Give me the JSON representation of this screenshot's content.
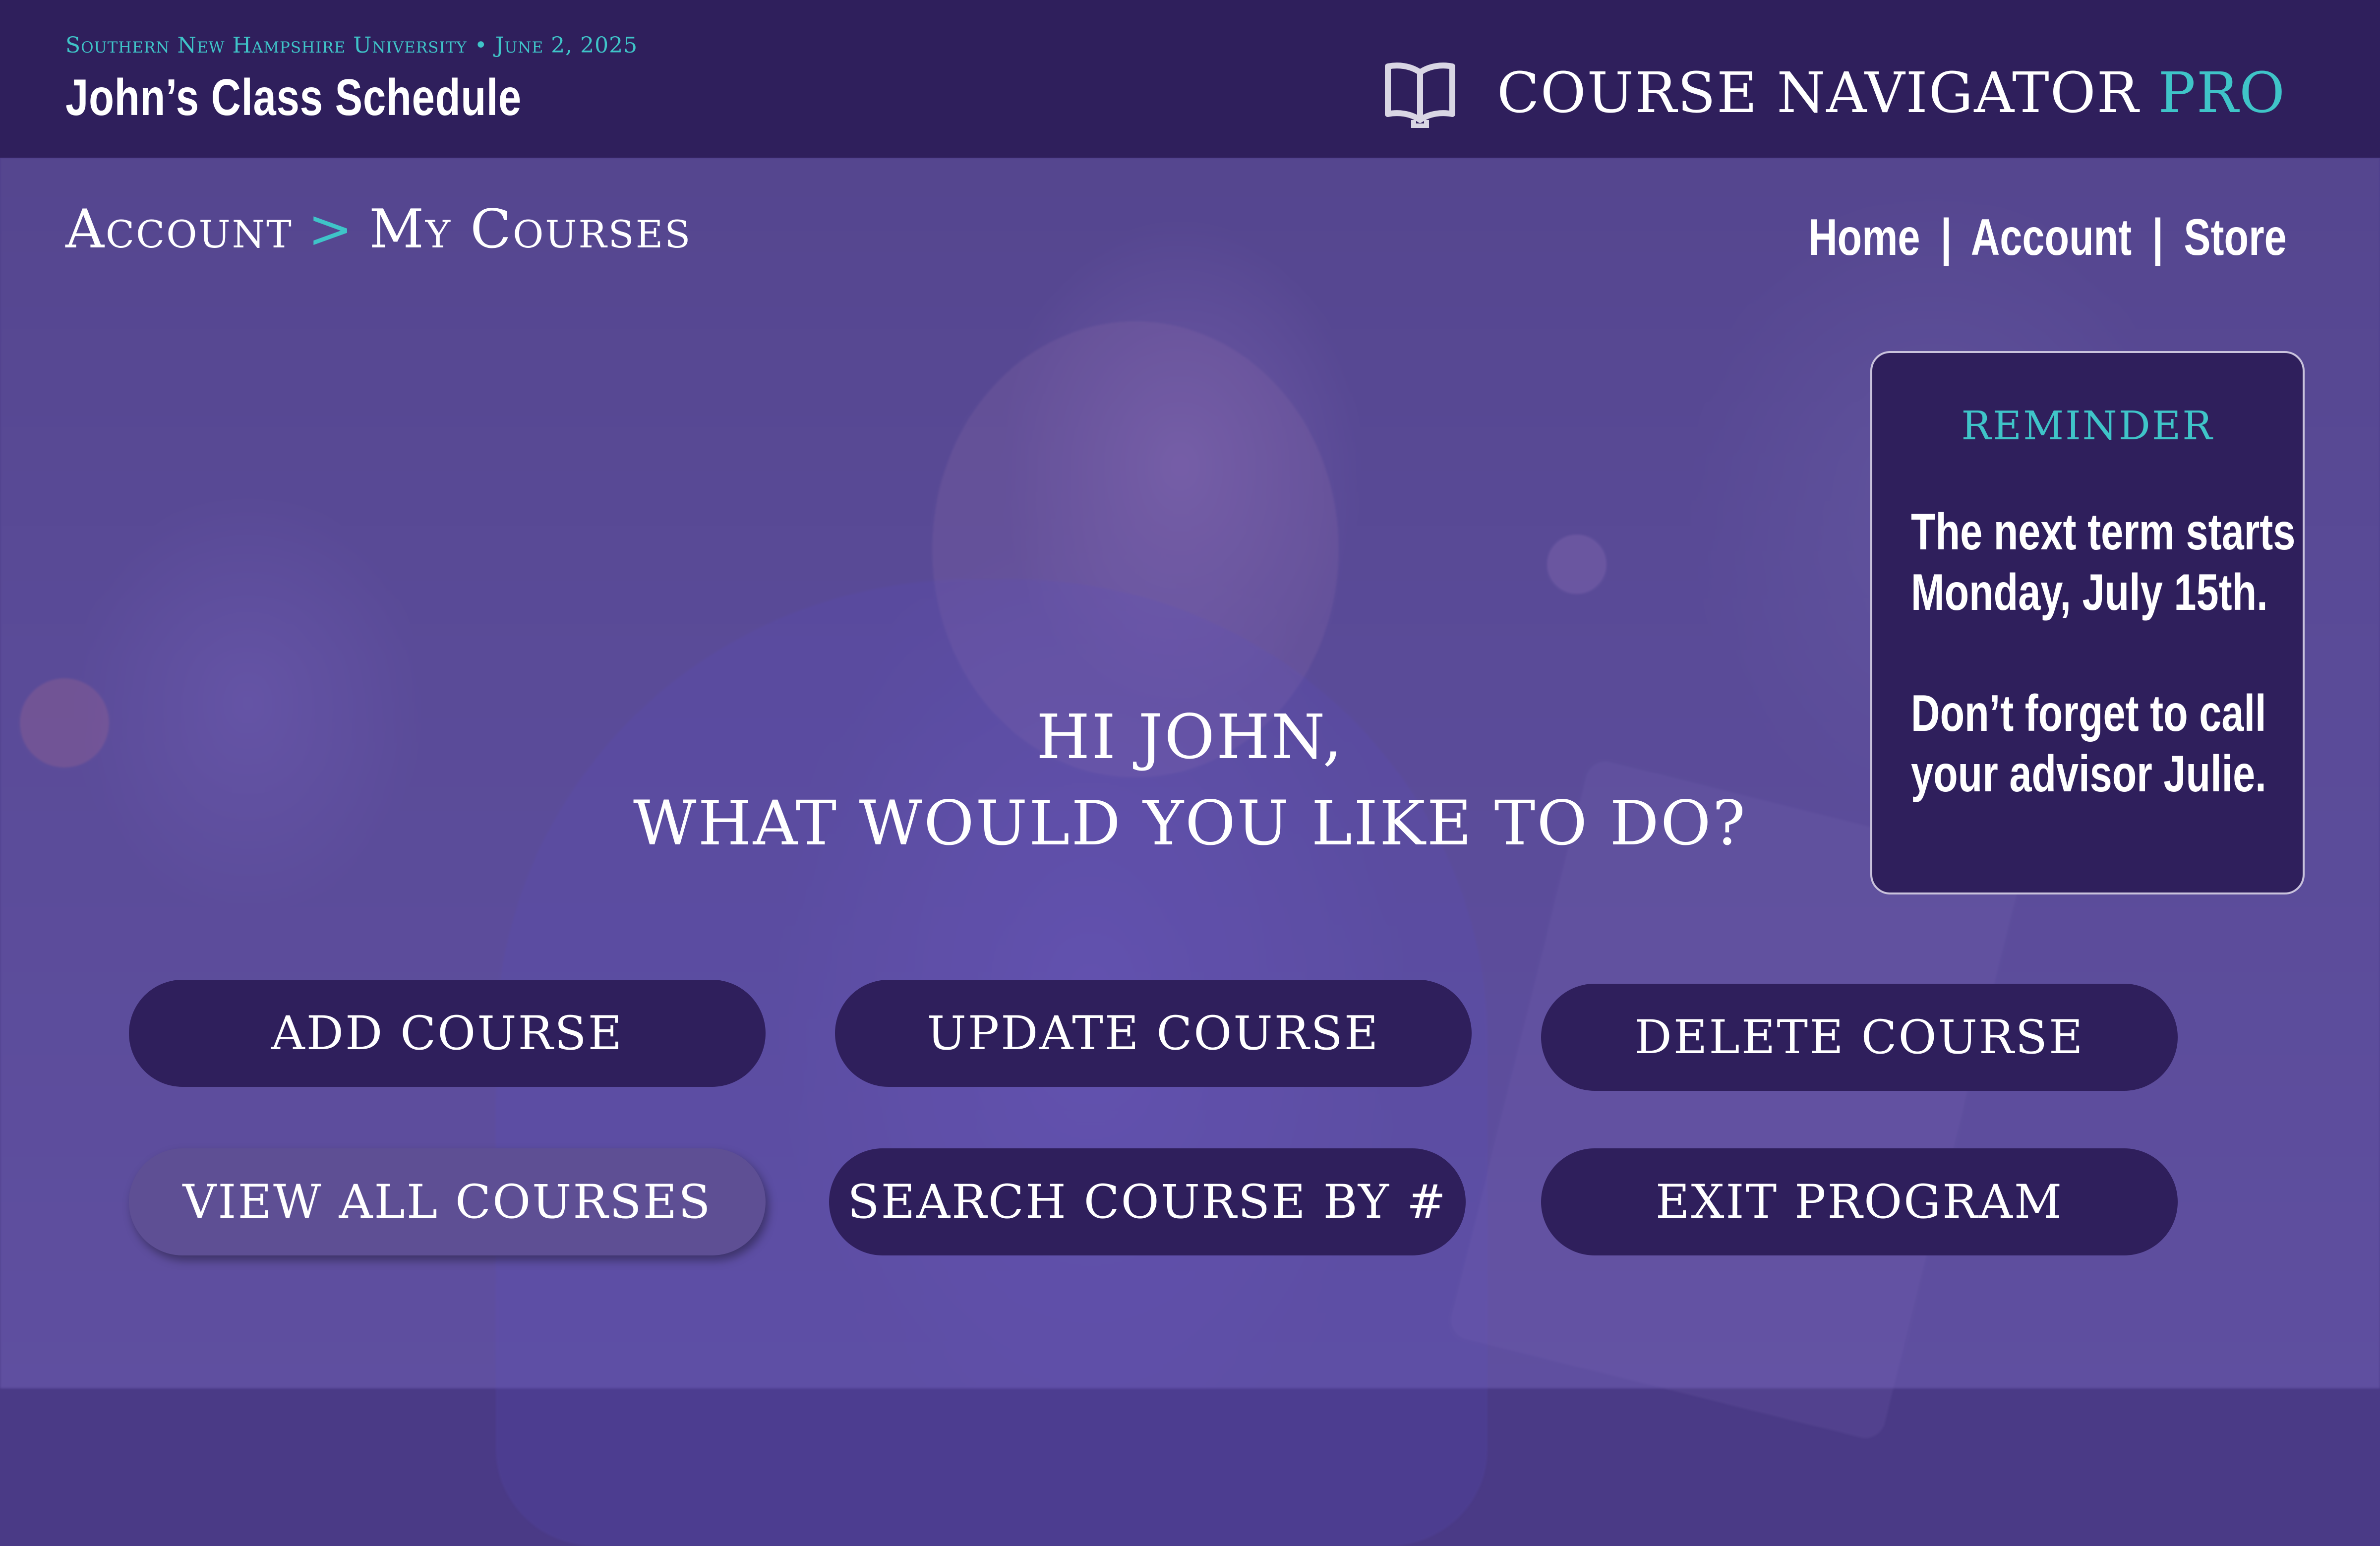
{
  "header": {
    "university": "Southern New Hampshire University • June 2, 2025",
    "schedule_title": "John’s Class Schedule",
    "brand_name": "COURSE NAVIGATOR",
    "brand_accent": "PRO",
    "brand_icon": "open-book-icon"
  },
  "breadcrumb": {
    "parent": "Account",
    "separator": ">",
    "current": "My Courses"
  },
  "nav": {
    "home": "Home",
    "account": "Account",
    "store": "Store",
    "separator": "|"
  },
  "reminder": {
    "title": "REMINDER",
    "line1": "The next term starts",
    "line2": "Monday, July 15th.",
    "line3": "Don’t forget to call",
    "line4": "your advisor Julie."
  },
  "greeting": {
    "line1": "HI JOHN,",
    "line2": "WHAT WOULD YOU LIKE TO DO?"
  },
  "actions": {
    "add": "ADD COURSE",
    "update": "UPDATE COURSE",
    "delete": "DELETE COURSE",
    "view_all": "VIEW ALL COURSES",
    "search": "SEARCH COURSE BY #",
    "exit": "EXIT PROGRAM",
    "active": "view_all"
  },
  "colors": {
    "header_bg": "#2f1f5c",
    "accent": "#3fc4c8",
    "button_bg": "#2f1f5c",
    "button_active_bg": "#5e4f94",
    "overlay": "#4a3a86"
  }
}
